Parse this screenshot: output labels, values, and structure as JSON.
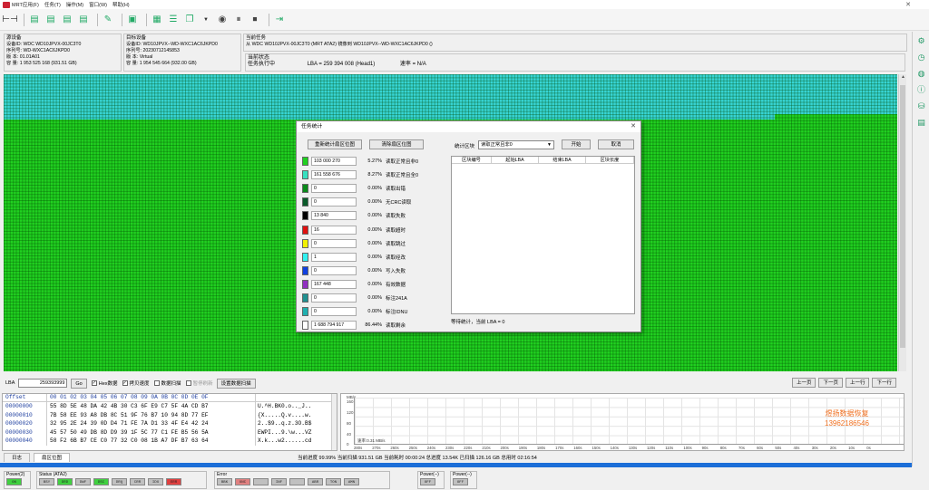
{
  "menu": {
    "items": [
      "MRT应用(F)",
      "任务(T)",
      "操作(M)",
      "窗口(W)",
      "帮助(H)"
    ],
    "window_close": "✕"
  },
  "toolbar": {
    "icons": [
      "copy-tool-icon",
      "disk-icon",
      "disk2-icon",
      "disk3-icon",
      "disk4-icon",
      "edit-icon",
      "save-icon",
      "sector-icon",
      "list-icon",
      "copy-icon",
      "dropdown-icon",
      "play-icon",
      "pause-icon",
      "stop-icon",
      "exit-icon"
    ]
  },
  "source": {
    "header": "源设备",
    "device_id": "设备ID: WDC WD10JPVX-00JC3T0",
    "serial": "序列号: WD-WXC1AC6JKPD0",
    "firmware": "版    本: 01.01A01",
    "capacity": "容    量: 1 953 525 168 (931.51 GB)"
  },
  "target": {
    "header": "目标设备",
    "device_id": "设备ID: WD10JPVX--WD-WXC1AC6JKPD0",
    "serial": "序列号: 20230712145853",
    "version": "版    本: Virtual",
    "capacity": "容    量: 1 954 545 664 (932.00 GB)"
  },
  "task": {
    "header": "当前任务",
    "description": "从 WDC WD10JPVX-00JC3T0 (MRT ATA2) 镜像到 WD10JPVX--WD-WXC1AC6JKPD0 ()",
    "status_header": "当前状态",
    "executing": "任务执行中",
    "lba": "LBA = 259 394 008 (Head1)",
    "speed": "速率 = N/A"
  },
  "lba_bar": {
    "label": "LBA",
    "value": "259393999",
    "go": "Go",
    "hex_label": "Hex数据",
    "hex_checked": "✓",
    "copy_speed": "拷贝速度",
    "copy_checked": "✓",
    "data_scan": "数据扫描",
    "pause_refresh": "暂停刷新",
    "set_scan": "设置数据扫描",
    "prev_page": "上一页",
    "next_page": "下一页",
    "prev_row": "上一行",
    "next_row": "下一行"
  },
  "hex": {
    "header_offset": "Offset",
    "header_bytes": "00 01 02 03 04 05 06 07 08 09 0A 0B 0C 0D 0E 0F",
    "rows": [
      {
        "offset": "00000000",
        "bytes": "55 8D 5E 48 DA 42 4B 30 C3 6F E9 C7 5F 4A CD B7",
        "ascii": "U.^H.BK0.o.._J.."
      },
      {
        "offset": "00000010",
        "bytes": "7B 58 EE 93 A8 DB 8C 51 9F 76 B7 10 94 8D 77 EF",
        "ascii": "{X.....Q.v....w."
      },
      {
        "offset": "00000020",
        "bytes": "32 95 2E 24 39 0D D4 71 FE 7A D1 33 4F E4 42 24",
        "ascii": "2..$9..q.z.3O.B$"
      },
      {
        "offset": "00000030",
        "bytes": "45 57 50 49 DB 8D D9 39 1F 5C 77 C1 FE B5 56 5A",
        "ascii": "EWPI...9.\\w...VZ"
      },
      {
        "offset": "00000040",
        "bytes": "58 F2 6B B7 CE C0 77 32 C0 08 1B A7 DF B7 63 64",
        "ascii": "X.k...w2......cd"
      }
    ]
  },
  "speed_chart": {
    "y_unit": "MB/s",
    "y_ticks": [
      "160",
      "120",
      "80",
      "40",
      "0"
    ],
    "x_ticks": [
      "280s",
      "270s",
      "260s",
      "250s",
      "240s",
      "230s",
      "220s",
      "210s",
      "200s",
      "190s",
      "180s",
      "170s",
      "160s",
      "150s",
      "140s",
      "130s",
      "120s",
      "110s",
      "100s",
      "90s",
      "80s",
      "70s",
      "60s",
      "50s",
      "40s",
      "30s",
      "20s",
      "10s",
      "0s"
    ],
    "speed_readout": "速率:0.31 MB/s",
    "brand_line1": "煜扬数据恢复",
    "brand_line2": "13962186546"
  },
  "tabs": [
    "日志",
    "扇区位图"
  ],
  "progress": {
    "text": "当前进度  99.99%  当前扫描  931.51 GB  当前耗时  00:00:24    总进度  13.54K  已扫描  126.16 GB  总用时  02:16:54",
    "fraction": 0.9999
  },
  "status": {
    "power1": {
      "label": "Power(2)",
      "leds": [
        {
          "text": "ON",
          "color": "#40d040"
        }
      ]
    },
    "status": {
      "label": "Status (ATA2)",
      "leds": [
        {
          "text": "BSY",
          "color": "#c0c0c0"
        },
        {
          "text": "DRD",
          "color": "#40d040"
        },
        {
          "text": "DWF",
          "color": "#c0c0c0"
        },
        {
          "text": "DSC",
          "color": "#40d040"
        },
        {
          "text": "DRQ",
          "color": "#c0c0c0"
        },
        {
          "text": "CRR",
          "color": "#c0c0c0"
        },
        {
          "text": "IDX",
          "color": "#c0c0c0"
        },
        {
          "text": "ERR",
          "color": "#e04040"
        }
      ]
    },
    "error": {
      "label": "Error",
      "leds": [
        {
          "text": "BBK",
          "color": "#c0c0c0"
        },
        {
          "text": "UNC",
          "color": "#e08080"
        },
        {
          "text": "",
          "color": "#c0c0c0"
        },
        {
          "text": "INF",
          "color": "#c0c0c0"
        },
        {
          "text": "",
          "color": "#c0c0c0"
        },
        {
          "text": "ABR",
          "color": "#c0c0c0"
        },
        {
          "text": "TON",
          "color": "#c0c0c0"
        },
        {
          "text": "AMN",
          "color": "#c0c0c0"
        }
      ]
    },
    "power2": {
      "label": "Power(--)",
      "leds": [
        {
          "text": "OFF",
          "color": "#c0c0c0"
        }
      ]
    },
    "power3": {
      "label": "Power(--)",
      "leds": [
        {
          "text": "OFF",
          "color": "#c0c0c0"
        }
      ]
    }
  },
  "dialog": {
    "title": "任务统计",
    "close": "✕",
    "rebuild_btn": "重新统计扇区位图",
    "clear_btn": "清除扇区位图",
    "block_label": "统计区块",
    "block_value": "读取正常且非0",
    "start_btn": "开始",
    "cancel_btn": "取消",
    "table_headers": [
      "区块编号",
      "起始LBA",
      "结束LBA",
      "区块长度"
    ],
    "footer": "等待统计，当前 LBA = 0",
    "stats": [
      {
        "color": "#20d020",
        "count": "103 000 270",
        "pct": "5.27%",
        "label": "读取正常且非0"
      },
      {
        "color": "#37e0c0",
        "count": "161 558 676",
        "pct": "8.27%",
        "label": "读取正常且全0"
      },
      {
        "color": "#0a8a1a",
        "count": "0",
        "pct": "0.00%",
        "label": "读取出错"
      },
      {
        "color": "#0a5a2a",
        "count": "0",
        "pct": "0.00%",
        "label": "无CRC读取"
      },
      {
        "color": "#000000",
        "count": "13 840",
        "pct": "0.00%",
        "label": "读取失败"
      },
      {
        "color": "#e01010",
        "count": "16",
        "pct": "0.00%",
        "label": "读取超时"
      },
      {
        "color": "#f0f000",
        "count": "0",
        "pct": "0.00%",
        "label": "读取跳过"
      },
      {
        "color": "#30f0f0",
        "count": "1",
        "pct": "0.00%",
        "label": "读取经改"
      },
      {
        "color": "#1040e0",
        "count": "0",
        "pct": "0.00%",
        "label": "写入失败"
      },
      {
        "color": "#9030c0",
        "count": "167 448",
        "pct": "0.00%",
        "label": "有效数据"
      },
      {
        "color": "#209090",
        "count": "0",
        "pct": "0.00%",
        "label": "标注241A"
      },
      {
        "color": "#20b0b0",
        "count": "0",
        "pct": "0.00%",
        "label": "标注IDNU"
      },
      {
        "color": "#ffffff",
        "count": "1 688 794 917",
        "pct": "86.44%",
        "label": "读取剩余"
      }
    ]
  },
  "rightbar_icons": [
    "settings-icon",
    "timer-icon",
    "globe-icon",
    "info-icon",
    "disk-tool-icon",
    "report-icon"
  ]
}
